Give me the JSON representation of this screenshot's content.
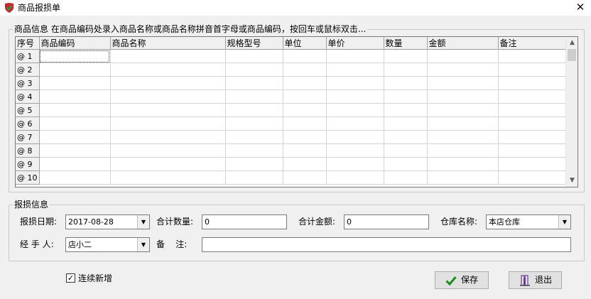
{
  "window": {
    "title": "商品报损单",
    "close_glyph": "✕"
  },
  "goods_group": {
    "legend": "商品信息 在商品编码处录入商品名称或商品名称拼音首字母或商品编码，按回车或鼠标双击..."
  },
  "grid": {
    "columns": [
      "序号",
      "商品编码",
      "商品名称",
      "规格型号",
      "单位",
      "单价",
      "数量",
      "金额",
      "备注"
    ],
    "rows": [
      "@ 1",
      "@ 2",
      "@ 3",
      "@ 4",
      "@ 5",
      "@ 6",
      "@ 7",
      "@ 8",
      "@ 9",
      "@ 10"
    ],
    "selected_row": 0,
    "selected_col": 1
  },
  "loss_group": {
    "legend": "报损信息",
    "date_label": "报损日期:",
    "date_value": "2017-08-28",
    "qty_label": "合计数量:",
    "qty_value": "0",
    "amount_label": "合计金额:",
    "amount_value": "0",
    "warehouse_label": "仓库名称:",
    "warehouse_value": "本店仓库",
    "handler_label": "经 手 人:",
    "handler_value": "店小二",
    "remark_label": "备    注:",
    "remark_value": ""
  },
  "footer": {
    "continuous_label": "连续新增",
    "continuous_checked": true,
    "save_label": "保存",
    "exit_label": "退出"
  },
  "icons": {
    "app": "shield-check-icon",
    "save": "check-icon",
    "exit": "exit-door-icon",
    "dropdown": "chevron-down-icon"
  },
  "colors": {
    "app_icon_red": "#c8282d",
    "app_icon_green": "#2e9a3c",
    "save_check": "#1d8a1d",
    "exit_icon": "#6b3b9b"
  }
}
